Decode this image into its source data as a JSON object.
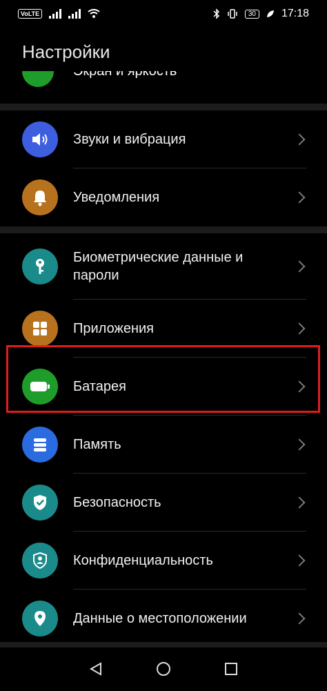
{
  "status_bar": {
    "volte": "VoLTE",
    "time": "17:18",
    "battery": "30"
  },
  "page_title": "Настройки",
  "partial_item": {
    "label": "Экран и яркость",
    "icon": "display-icon",
    "color": "#1f9d2b"
  },
  "groups": [
    {
      "items": [
        {
          "label": "Звуки и вибрация",
          "icon": "volume-icon",
          "color": "#3e5ee0"
        },
        {
          "label": "Уведомления",
          "icon": "bell-icon",
          "color": "#b8721d"
        }
      ]
    },
    {
      "items": [
        {
          "label": "Биометрические данные и пароли",
          "icon": "key-icon",
          "color": "#1b8a8a"
        },
        {
          "label": "Приложения",
          "icon": "apps-grid-icon",
          "color": "#b8721d"
        },
        {
          "label": "Батарея",
          "icon": "battery-icon",
          "color": "#1f9d2b"
        },
        {
          "label": "Память",
          "icon": "storage-icon",
          "color": "#2a6be0"
        },
        {
          "label": "Безопасность",
          "icon": "shield-check-icon",
          "color": "#1b8a8a"
        },
        {
          "label": "Конфиденциальность",
          "icon": "privacy-icon",
          "color": "#1b8a8a"
        },
        {
          "label": "Данные о местоположении",
          "icon": "location-pin-icon",
          "color": "#1b8a8a"
        }
      ]
    }
  ],
  "highlight_color": "#e21b1b",
  "nav": [
    "back-icon",
    "home-icon",
    "recents-icon"
  ]
}
